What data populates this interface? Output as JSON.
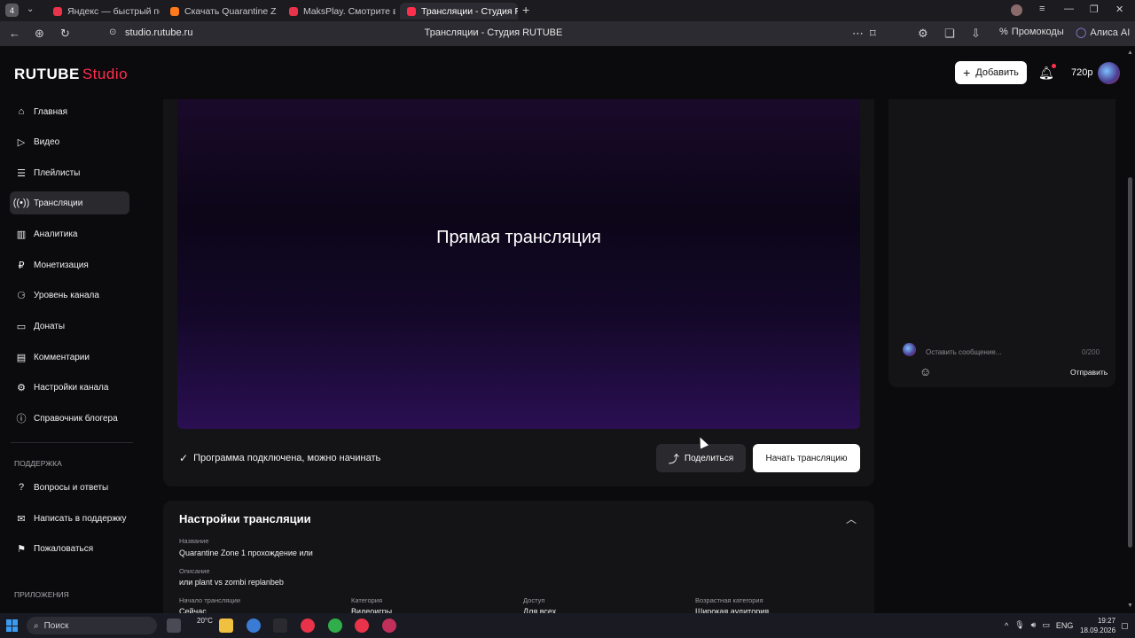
{
  "browser": {
    "tabs": [
      {
        "label": "Яндекс — быстрый поиск",
        "color": "#e8334a"
      },
      {
        "label": "Скачать Quarantine Zone",
        "color": "#ff7a1a"
      },
      {
        "label": "MaksPlay. Смотрите вид",
        "color": "#e8334a"
      },
      {
        "label": "Трансляции - Студия R",
        "color": "#ff2e4d"
      }
    ],
    "url": "studio.rutube.ru",
    "page_title": "Трансляции - Студия RUTUBE",
    "promo_label": "Промокоды",
    "alice_label": "Алиса AI"
  },
  "header": {
    "logo_text": "RUTUBE",
    "logo_suffix": "Studio",
    "add_label": "Добавить",
    "quality": "720p"
  },
  "sidebar": {
    "items": [
      {
        "label": "Главная",
        "icon": "home-icon"
      },
      {
        "label": "Видео",
        "icon": "video-icon"
      },
      {
        "label": "Плейлисты",
        "icon": "playlist-icon"
      },
      {
        "label": "Трансляции",
        "icon": "broadcast-icon"
      },
      {
        "label": "Аналитика",
        "icon": "analytics-icon"
      },
      {
        "label": "Монетизация",
        "icon": "monetization-icon"
      },
      {
        "label": "Уровень канала",
        "icon": "level-icon"
      },
      {
        "label": "Донаты",
        "icon": "donate-icon"
      },
      {
        "label": "Комментарии",
        "icon": "comments-icon"
      },
      {
        "label": "Настройки канала",
        "icon": "settings-icon"
      },
      {
        "label": "Справочник блогера",
        "icon": "info-icon"
      }
    ],
    "support_title": "ПОДДЕРЖКА",
    "support_items": [
      {
        "label": "Вопросы и ответы",
        "icon": "question-icon"
      },
      {
        "label": "Написать в поддержку",
        "icon": "mail-icon"
      },
      {
        "label": "Пожаловаться",
        "icon": "flag-icon"
      }
    ],
    "apps_title": "ПРИЛОЖЕНИЯ"
  },
  "player": {
    "title": "Прямая трансляция",
    "status": "Программа подключена, можно начинать",
    "share_label": "Поделиться",
    "start_label": "Начать трансляцию"
  },
  "chat": {
    "placeholder": "Оставить сообщение...",
    "counter": "0/200",
    "send_label": "Отправить"
  },
  "settings": {
    "title": "Настройки трансляции",
    "name_label": "Название",
    "name_value": "Quarantine Zone 1 прохождение или",
    "desc_label": "Описание",
    "desc_value": "или plant vs zombi replanbeb",
    "start_label": "Начало трансляции",
    "start_value": "Сейчас",
    "category_label": "Категория",
    "category_value": "Видеоигры",
    "access_label": "Доступ",
    "access_value": "Для всех",
    "age_label": "Возрастная категория",
    "age_value": "Широкая аудитория"
  },
  "taskbar": {
    "search_label": "Поиск",
    "weather": "20°C",
    "lang": "ENG",
    "time": "19:27",
    "date": "18.09.2026"
  },
  "colors": {
    "accent": "#ff2e4d",
    "background": "#0b0b0d",
    "card": "#141416"
  }
}
